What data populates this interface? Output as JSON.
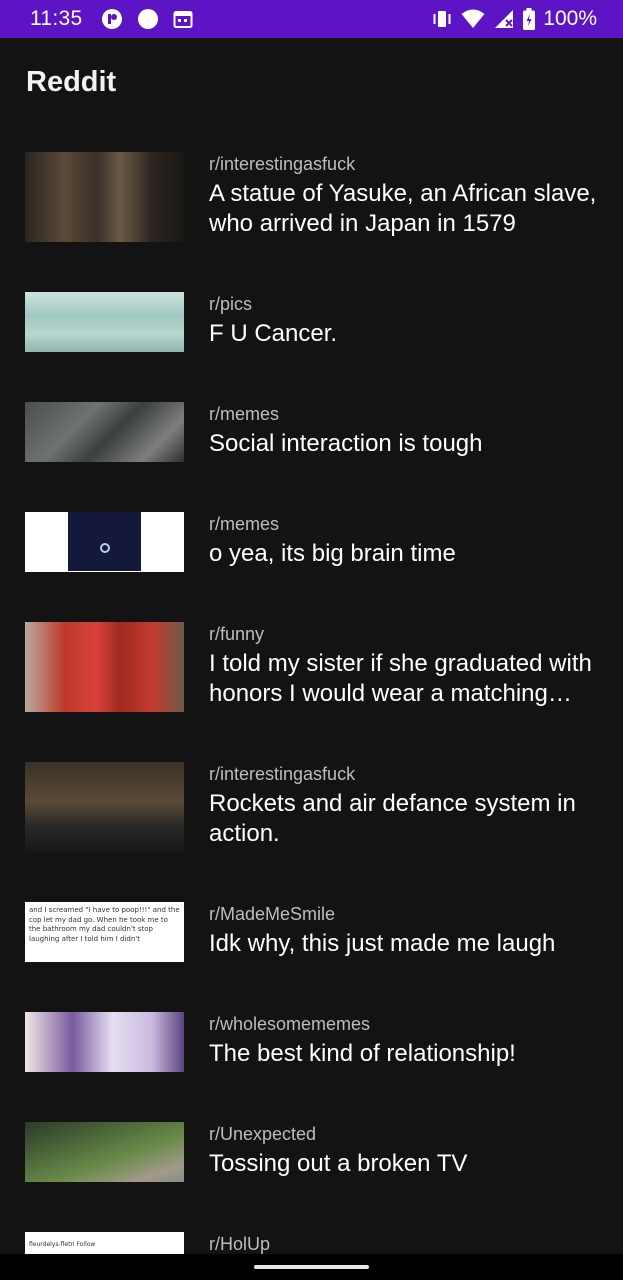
{
  "status_bar": {
    "time": "11:35",
    "battery": "100%",
    "icons": [
      "app-notification-icon",
      "circle-notification-icon",
      "calendar-icon",
      "vibrate-icon",
      "wifi-icon",
      "signal-icon",
      "battery-icon"
    ]
  },
  "app": {
    "title": "Reddit"
  },
  "posts": [
    {
      "subreddit": "r/interestingasfuck",
      "title": "A statue of Yasuke, an African slave, who arrived in Japan in 1579",
      "thumbnail": "statue-photo"
    },
    {
      "subreddit": "r/pics",
      "title": "F U Cancer.",
      "thumbnail": "hospital-gown-photo"
    },
    {
      "subreddit": "r/memes",
      "title": "Social interaction is tough",
      "thumbnail": "tree-roots-photo"
    },
    {
      "subreddit": "r/memes",
      "title": "o yea, its big brain time",
      "thumbnail": "dark-screen-image"
    },
    {
      "subreddit": "r/funny",
      "title": "I told my sister if she graduated with honors I would wear a matching dress",
      "thumbnail": "red-dresses-photo"
    },
    {
      "subreddit": "r/interestingasfuck",
      "title": "Rockets and air defance system in action.",
      "thumbnail": "night-sky-rockets-photo"
    },
    {
      "subreddit": "r/MadeMeSmile",
      "title": "Idk why, this just made me laugh",
      "thumbnail": "text-screenshot",
      "thumbnail_text": "and I screamed \"I have to poop!!!\" and the cop let my dad go. When he took me to the bathroom my dad couldn't stop laughing after I told him I didn't"
    },
    {
      "subreddit": "r/wholesomememes",
      "title": "The best kind of relationship!",
      "thumbnail": "comic-panel"
    },
    {
      "subreddit": "r/Unexpected",
      "title": "Tossing out a broken TV",
      "thumbnail": "yard-photo"
    },
    {
      "subreddit": "r/HolUp",
      "title": "",
      "thumbnail": "social-post-screenshot",
      "thumbnail_text": "fleurdelys-fletri  Follow"
    }
  ],
  "colors": {
    "status_bar": "#5c14c4",
    "background": "#131313",
    "subreddit_text": "#bdbdbd",
    "title_text": "#ffffff"
  }
}
